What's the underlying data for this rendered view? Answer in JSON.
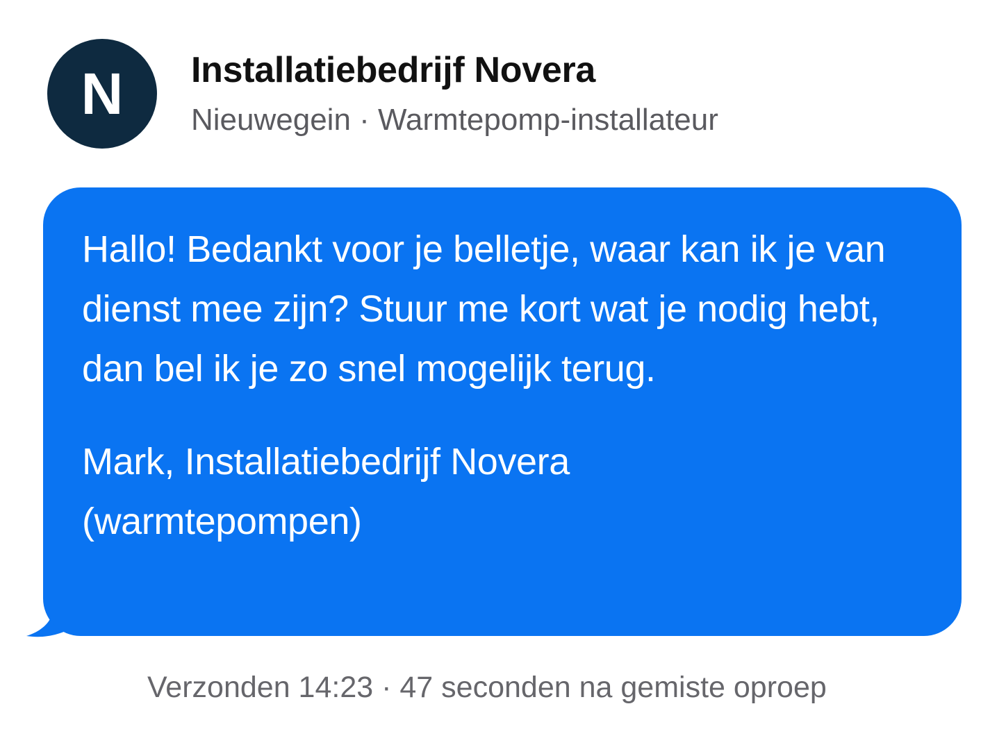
{
  "contact": {
    "avatar_letter": "N",
    "name": "Installatiebedrijf Novera",
    "subtitle": "Nieuwegein · Warmtepomp-installateur"
  },
  "message": {
    "body": "Hallo! Bedankt voor je belletje, waar kan ik je van dienst mee zijn? Stuur me kort wat je nodig hebt, dan bel ik je zo snel mogelijk terug.",
    "signature_line1": "Mark, Installatiebedrijf Novera",
    "signature_line2": "(warmtepompen)",
    "bubble_color": "#0a74f2",
    "text_color": "#ffffff"
  },
  "status": {
    "text": "Verzonden 14:23 · 47 seconden na gemiste oproep"
  },
  "colors": {
    "avatar_bg": "#0e2a40",
    "background": "#ffffff"
  }
}
